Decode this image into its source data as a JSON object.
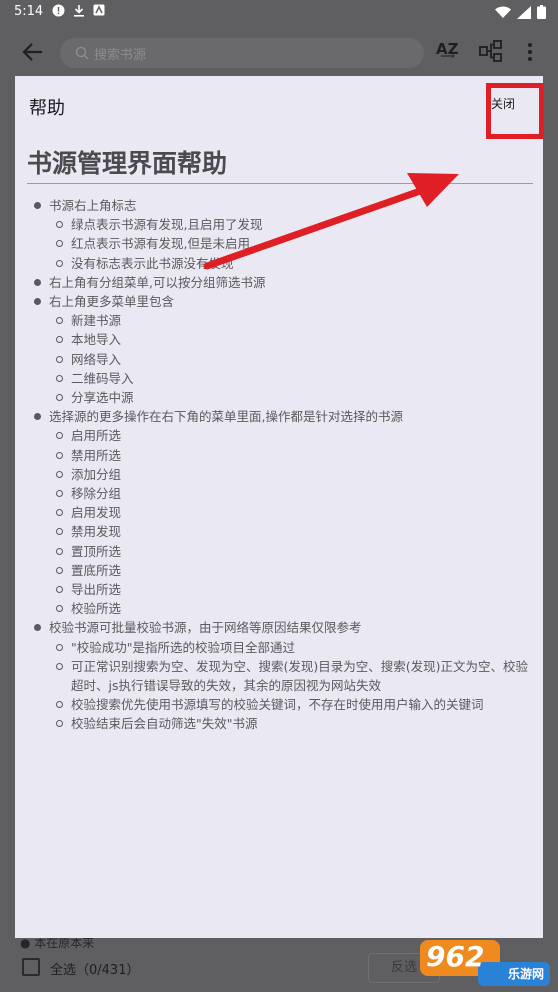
{
  "status_bar": {
    "time": "5:14"
  },
  "app_bar": {
    "search_placeholder": "搜索书源",
    "sort_icon_text": "A͢Z"
  },
  "bottom_bar": {
    "partial_text": "● 本在原本来",
    "select_all_label": "全选（0/431）",
    "invert_label": "反选"
  },
  "dialog": {
    "title": "帮助",
    "close_label": "关闭",
    "heading": "书源管理界面帮助",
    "sections": [
      {
        "text": "书源右上角标志",
        "items": [
          "绿点表示书源有发现,且启用了发现",
          "红点表示书源有发现,但是未启用",
          "没有标志表示此书源没有发现"
        ]
      },
      {
        "text": "右上角有分组菜单,可以按分组筛选书源",
        "items": []
      },
      {
        "text": "右上角更多菜单里包含",
        "items": [
          "新建书源",
          "本地导入",
          "网络导入",
          "二维码导入",
          "分享选中源"
        ]
      },
      {
        "text": "选择源的更多操作在右下角的菜单里面,操作都是针对选择的书源",
        "items": [
          "启用所选",
          "禁用所选",
          "添加分组",
          "移除分组",
          "启用发现",
          "禁用发现",
          "置顶所选",
          "置底所选",
          "导出所选",
          "校验所选"
        ]
      },
      {
        "text": "校验书源可批量校验书源，由于网络等原因结果仅限参考",
        "items": [
          "\"校验成功\"是指所选的校验项目全部通过",
          "可正常识别搜索为空、发现为空、搜索(发现)目录为空、搜索(发现)正文为空、校验超时、js执行错误导致的失效，其余的原因视为网站失效",
          "校验搜索优先使用书源填写的校验关键词，不存在时使用用户输入的关键词",
          "校验结束后会自动筛选\"失效\"书源"
        ]
      }
    ]
  },
  "watermark": {
    "number": "962",
    "text": "乐游网"
  },
  "colors": {
    "annotation_red": "#e01e25",
    "dialog_bg": "#eae8f3"
  }
}
